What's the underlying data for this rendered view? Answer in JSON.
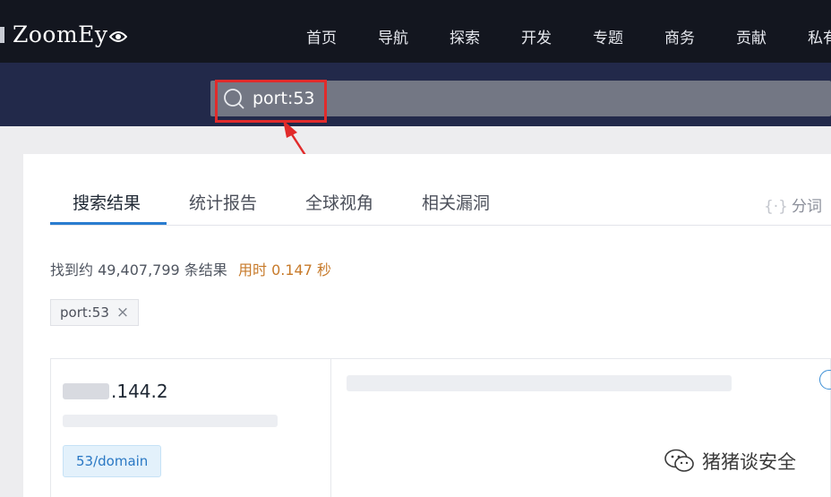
{
  "header": {
    "logo_text": "ZoomEy",
    "nav": [
      {
        "label": "首页"
      },
      {
        "label": "导航"
      },
      {
        "label": "探索"
      },
      {
        "label": "开发"
      },
      {
        "label": "专题"
      },
      {
        "label": "商务"
      },
      {
        "label": "贡献"
      },
      {
        "label": "私有"
      }
    ]
  },
  "search": {
    "query": "port:53",
    "icon": "search-icon"
  },
  "tabs": [
    {
      "label": "搜索结果",
      "active": true
    },
    {
      "label": "统计报告",
      "active": false
    },
    {
      "label": "全球视角",
      "active": false
    },
    {
      "label": "相关漏洞",
      "active": false
    }
  ],
  "fenci": {
    "bracket": "{·}",
    "label": "分词"
  },
  "results": {
    "count_text": "找到约 49,407,799 条结果",
    "time_text": "用时 0.147 秒"
  },
  "filter_tag": {
    "label": "port:53",
    "close": "×"
  },
  "result_item": {
    "ip_visible": ".144.2",
    "badge": "53/domain"
  },
  "watermark": {
    "text": "猪猪谈安全"
  },
  "colors": {
    "topbar": "#13161f",
    "search_band": "#22294a",
    "accent_blue": "#2a7ccf",
    "highlight_red": "#e12b2b",
    "time_orange": "#c77a2a"
  }
}
